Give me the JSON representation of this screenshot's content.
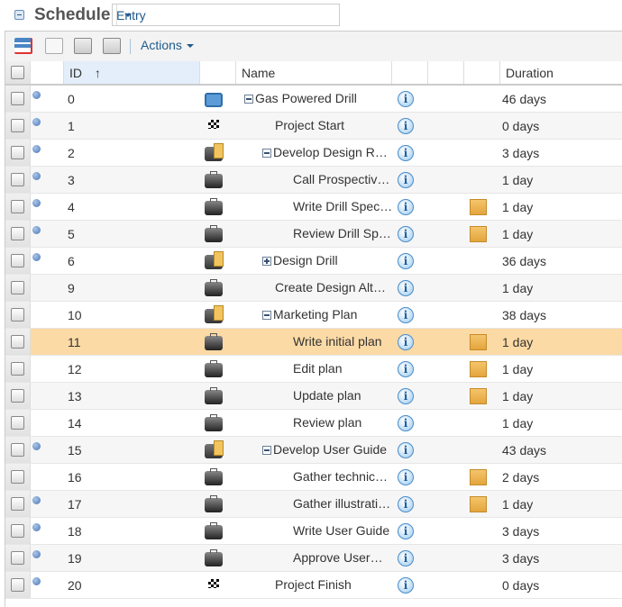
{
  "header": {
    "title": "Schedule",
    "view_select": "Entry"
  },
  "toolbar": {
    "actions_label": "Actions"
  },
  "columns": {
    "id": "ID",
    "sort_indicator": "↑",
    "name": "Name",
    "duration": "Duration"
  },
  "colors": {
    "selected_row": "#fcdaa5",
    "link": "#1f5a8c"
  },
  "rows": [
    {
      "id": "0",
      "name": "Gas Powered Drill",
      "duration": "46 days",
      "level": 0,
      "toggle": "minus",
      "type": "project",
      "dot": true,
      "note": false
    },
    {
      "id": "1",
      "name": "Project Start",
      "duration": "0 days",
      "level": 1,
      "type": "milestone",
      "dot": true,
      "note": false
    },
    {
      "id": "2",
      "name": "Develop Design R…",
      "duration": "3 days",
      "level": 1,
      "toggle": "minus",
      "type": "summary",
      "dot": true,
      "note": false
    },
    {
      "id": "3",
      "name": "Call Prospectiv…",
      "duration": "1 day",
      "level": 2,
      "type": "task",
      "dot": true,
      "note": false
    },
    {
      "id": "4",
      "name": "Write Drill Spec…",
      "duration": "1 day",
      "level": 2,
      "type": "task",
      "dot": true,
      "note": true
    },
    {
      "id": "5",
      "name": "Review Drill Sp…",
      "duration": "1 day",
      "level": 2,
      "type": "task",
      "dot": true,
      "note": true
    },
    {
      "id": "6",
      "name": "Design Drill",
      "duration": "36 days",
      "level": 1,
      "toggle": "plus",
      "type": "summary",
      "dot": true,
      "note": false
    },
    {
      "id": "9",
      "name": "Create Design Alt…",
      "duration": "1 day",
      "level": 1,
      "type": "task",
      "dot": false,
      "note": false
    },
    {
      "id": "10",
      "name": "Marketing Plan",
      "duration": "38 days",
      "level": 1,
      "toggle": "minus",
      "type": "summary",
      "dot": false,
      "note": false
    },
    {
      "id": "11",
      "name": "Write initial plan",
      "duration": "1 day",
      "level": 2,
      "type": "task",
      "dot": false,
      "note": true,
      "selected": true
    },
    {
      "id": "12",
      "name": "Edit plan",
      "duration": "1 day",
      "level": 2,
      "type": "task",
      "dot": false,
      "note": true
    },
    {
      "id": "13",
      "name": "Update plan",
      "duration": "1 day",
      "level": 2,
      "type": "task",
      "dot": false,
      "note": true
    },
    {
      "id": "14",
      "name": "Review plan",
      "duration": "1 day",
      "level": 2,
      "type": "task",
      "dot": false,
      "note": false
    },
    {
      "id": "15",
      "name": "Develop User Guide",
      "duration": "43 days",
      "level": 1,
      "toggle": "minus",
      "type": "summary",
      "dot": true,
      "note": false
    },
    {
      "id": "16",
      "name": "Gather technic…",
      "duration": "2 days",
      "level": 2,
      "type": "task",
      "dot": false,
      "note": true
    },
    {
      "id": "17",
      "name": "Gather illustrati…",
      "duration": "1 day",
      "level": 2,
      "type": "task",
      "dot": true,
      "note": true
    },
    {
      "id": "18",
      "name": "Write User Guide",
      "duration": "3 days",
      "level": 2,
      "type": "task",
      "dot": true,
      "note": false
    },
    {
      "id": "19",
      "name": "Approve User…",
      "duration": "3 days",
      "level": 2,
      "type": "task",
      "dot": true,
      "note": false
    },
    {
      "id": "20",
      "name": "Project Finish",
      "duration": "0 days",
      "level": 1,
      "type": "milestone",
      "dot": true,
      "note": false
    }
  ]
}
